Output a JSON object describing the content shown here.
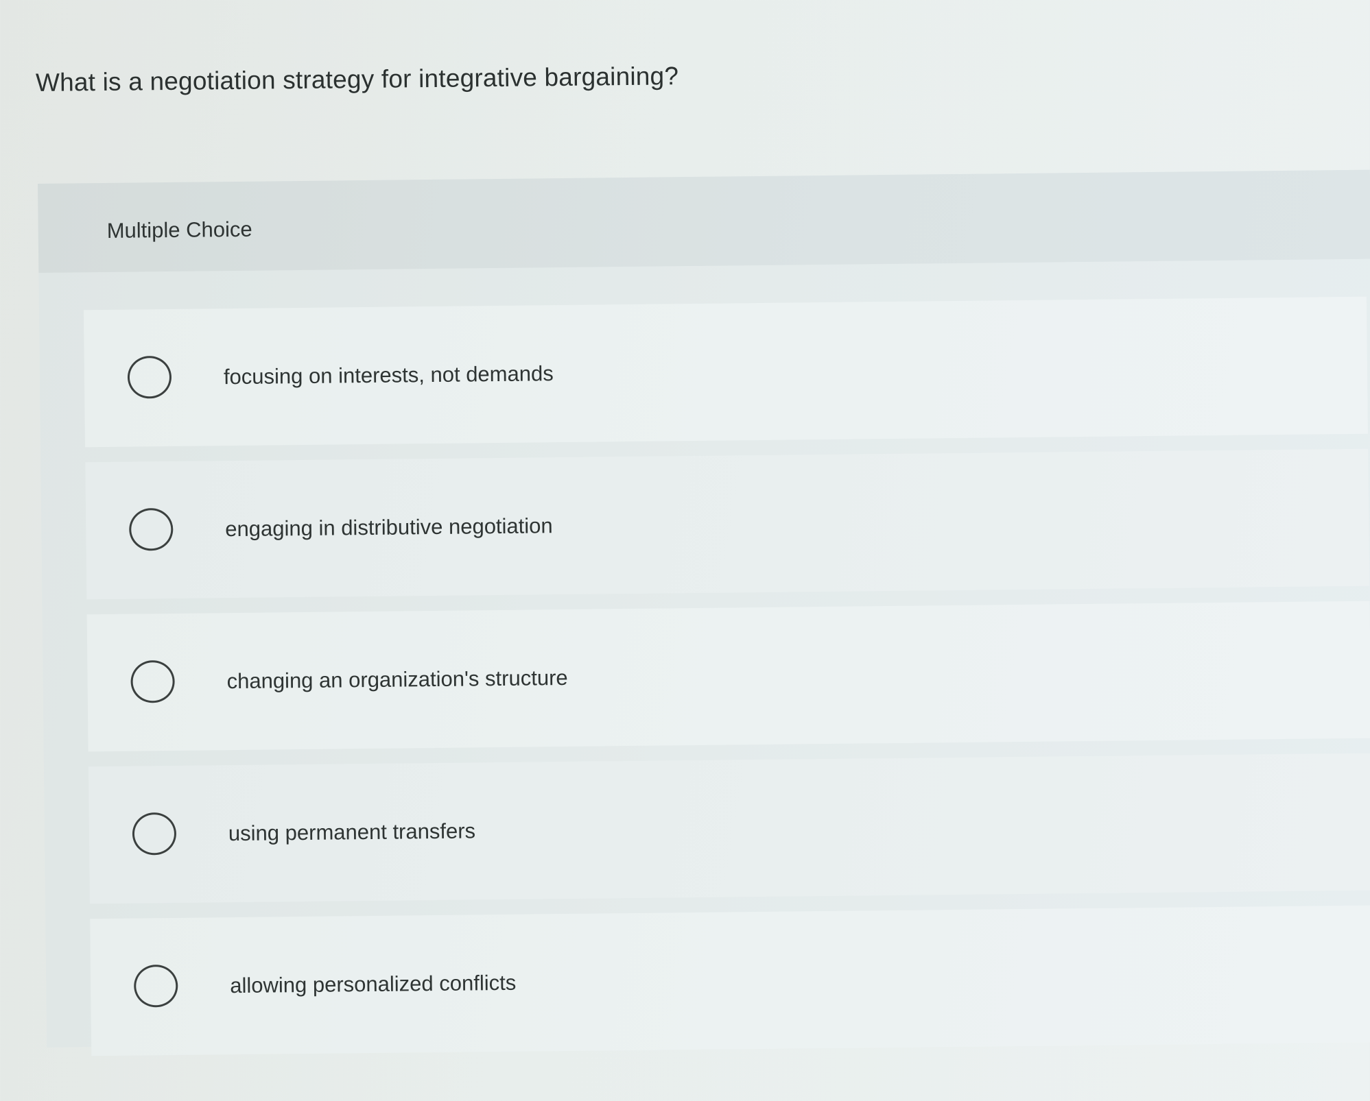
{
  "question": {
    "text": "What is a negotiation strategy for integrative bargaining?"
  },
  "panel": {
    "type_label": "Multiple Choice"
  },
  "options": [
    {
      "label": "focusing on interests, not demands"
    },
    {
      "label": "engaging in distributive negotiation"
    },
    {
      "label": "changing an organization's structure"
    },
    {
      "label": "using permanent transfers"
    },
    {
      "label": "allowing personalized conflicts"
    }
  ]
}
